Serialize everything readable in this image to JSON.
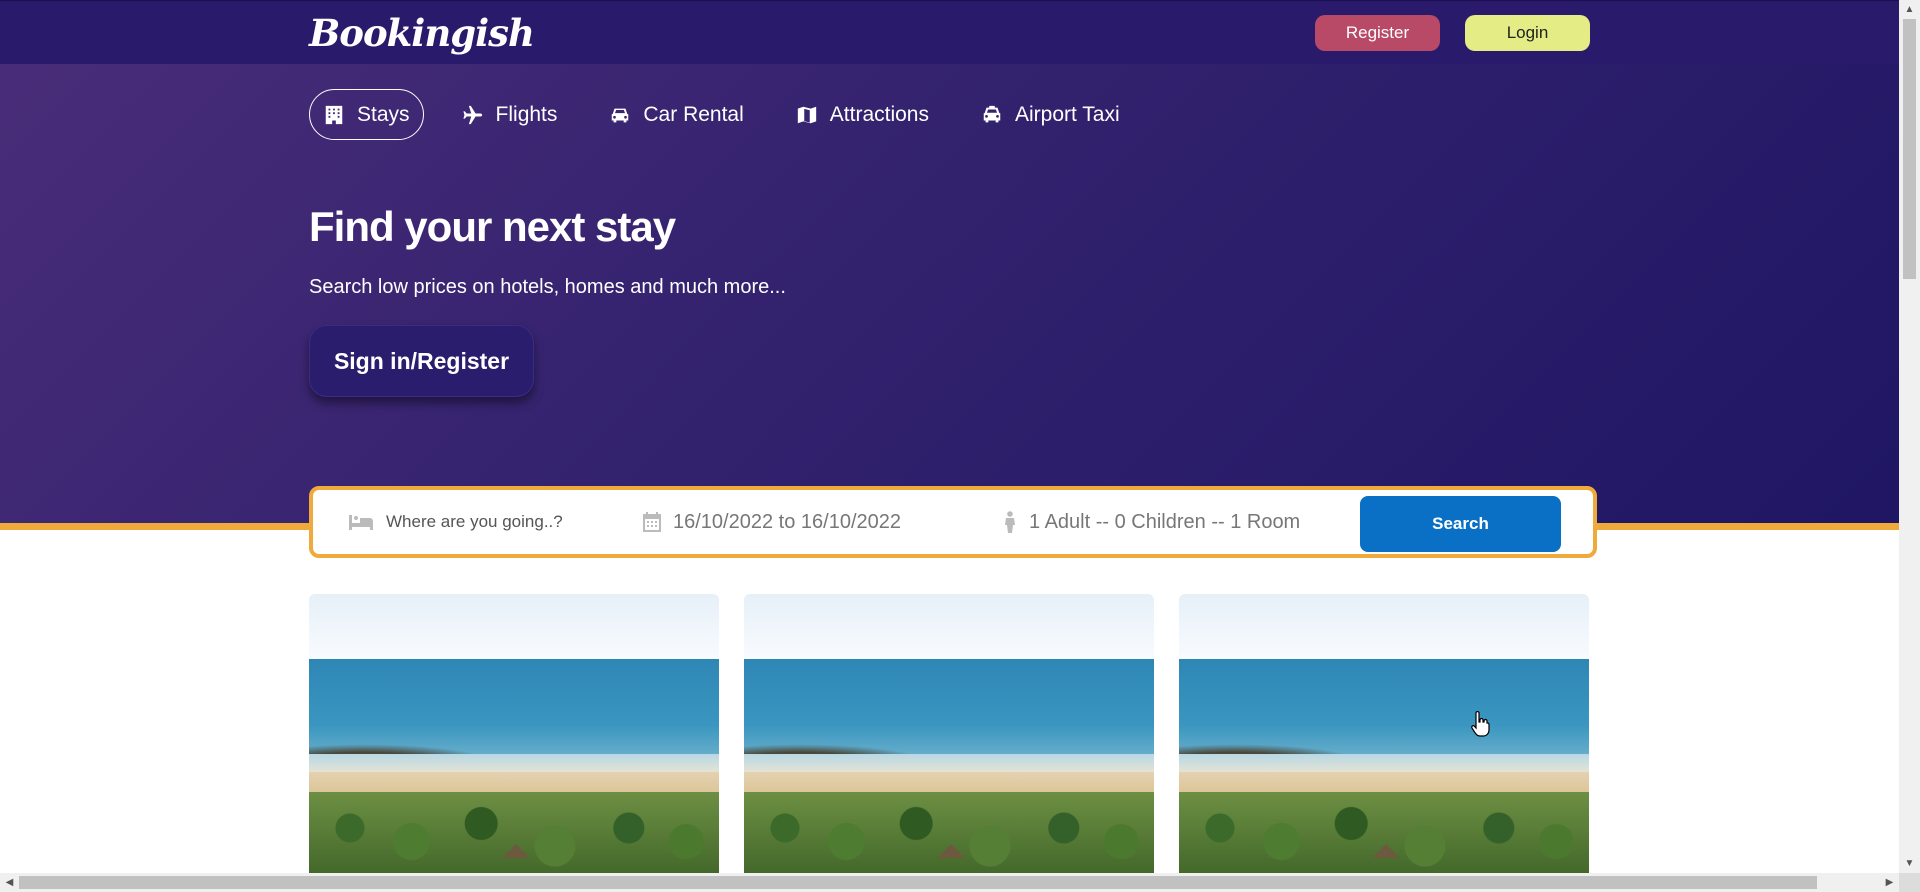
{
  "header": {
    "logo": "Bookingish",
    "register_label": "Register",
    "login_label": "Login"
  },
  "nav": {
    "items": [
      {
        "label": "Stays",
        "icon": "building-icon",
        "active": true
      },
      {
        "label": "Flights",
        "icon": "plane-icon"
      },
      {
        "label": "Car Rental",
        "icon": "car-icon"
      },
      {
        "label": "Attractions",
        "icon": "map-icon"
      },
      {
        "label": "Airport Taxi",
        "icon": "taxi-icon"
      }
    ]
  },
  "hero": {
    "title": "Find your next stay",
    "subtitle": "Search low prices on hotels, homes and much more...",
    "signin_label": "Sign in/Register"
  },
  "search": {
    "destination_placeholder": "Where are you going..?",
    "dates": "16/10/2022 to 16/10/2022",
    "guests": "1 Adult -- 0 Children -- 1 Room",
    "button_label": "Search"
  },
  "cards": [
    {
      "image": "beach-image"
    },
    {
      "image": "beach-image"
    },
    {
      "image": "beach-image"
    }
  ],
  "colors": {
    "hero_bg": "#33226e",
    "topbar_bg": "#2a1a6c",
    "register_bg": "#b84a68",
    "login_bg": "#e4ec86",
    "accent_orange": "#f0a93b",
    "search_button": "#0970c6"
  }
}
